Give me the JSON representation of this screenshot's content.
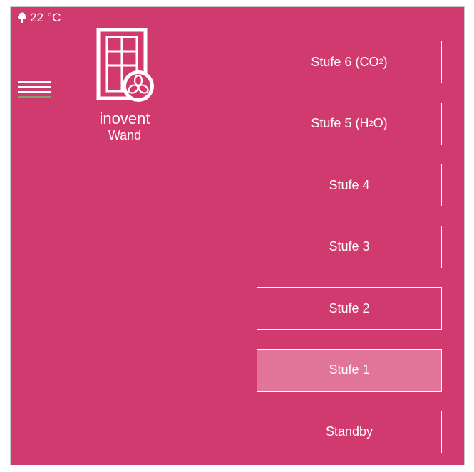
{
  "status": {
    "temperature": "22 °C",
    "icon": "tree-icon"
  },
  "menu": {
    "icon": "hamburger-menu-icon"
  },
  "device": {
    "icon": "window-fan-icon",
    "name": "inovent",
    "location": "Wand"
  },
  "levels": [
    {
      "label": "Stufe 6 (CO",
      "sub": "2",
      "suffix": ")",
      "active": false
    },
    {
      "label": "Stufe 5 (H",
      "sub": "2",
      "suffix": "O)",
      "active": false
    },
    {
      "label": "Stufe 4",
      "active": false
    },
    {
      "label": "Stufe 3",
      "active": false
    },
    {
      "label": "Stufe 2",
      "active": false
    },
    {
      "label": "Stufe 1",
      "active": true
    },
    {
      "label": "Standby",
      "active": false
    }
  ],
  "colors": {
    "background": "#d03a6e",
    "active_button": "#e07599",
    "menu_accent": "#7fa36a"
  }
}
